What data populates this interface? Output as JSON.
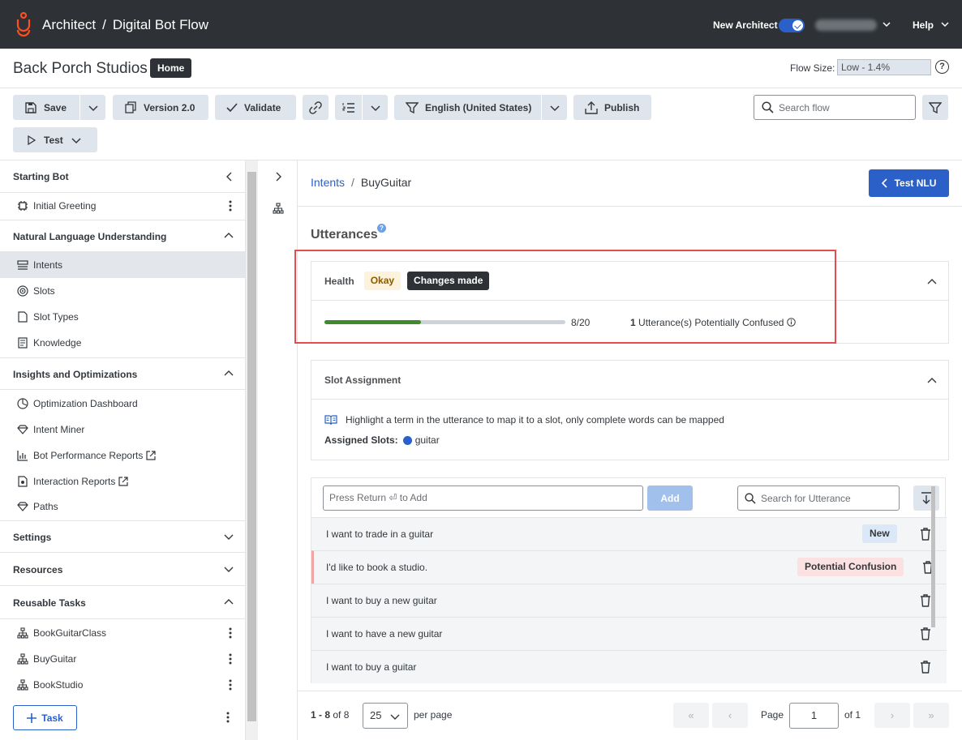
{
  "header": {
    "app_name": "Architect",
    "separator": "/",
    "flow_type": "Digital Bot Flow",
    "new_architect_label": "New Architect",
    "new_architect_enabled": true,
    "help_label": "Help"
  },
  "org": {
    "name": "Back Porch Studios",
    "home_label": "Home",
    "flow_size_label": "Flow Size:",
    "flow_size_value": "Low - 1.4%"
  },
  "toolbar": {
    "save_label": "Save",
    "version_label": "Version 2.0",
    "validate_label": "Validate",
    "language_label": "English (United States)",
    "publish_label": "Publish",
    "test_label": "Test",
    "search_placeholder": "Search flow"
  },
  "sidebar": {
    "starting_bot_header": "Starting Bot",
    "initial_greeting": "Initial Greeting",
    "nlu_header": "Natural Language Understanding",
    "nlu_items": [
      "Intents",
      "Slots",
      "Slot Types",
      "Knowledge"
    ],
    "insights_header": "Insights and Optimizations",
    "insights_items": [
      "Optimization Dashboard",
      "Intent Miner",
      "Bot Performance Reports",
      "Interaction Reports",
      "Paths"
    ],
    "settings_header": "Settings",
    "resources_header": "Resources",
    "reusable_header": "Reusable Tasks",
    "tasks": [
      "BookGuitarClass",
      "BuyGuitar",
      "BookStudio"
    ],
    "add_task_label": "Task"
  },
  "main": {
    "breadcrumb_root": "Intents",
    "breadcrumb_sep": "/",
    "breadcrumb_current": "BuyGuitar",
    "test_nlu_label": "Test NLU",
    "utterances_title": "Utterances",
    "health": {
      "label": "Health",
      "status": "Okay",
      "changes": "Changes made",
      "progress_current": 8,
      "progress_total": 20,
      "progress_text": "8/20",
      "confused_count": "1",
      "confused_text": "Utterance(s) Potentially Confused"
    },
    "slot_assignment": {
      "title": "Slot Assignment",
      "hint": "Highlight a term in the utterance to map it to a slot, only complete words can be mapped",
      "assigned_label": "Assigned Slots:",
      "slot_name": "guitar",
      "slot_color": "#2a60c8"
    },
    "utterance_input_placeholder": "Press Return ⏎ to Add",
    "add_label": "Add",
    "utterance_search_placeholder": "Search for Utterance",
    "utterances": [
      {
        "text": "I want to trade in a guitar",
        "badge": "New"
      },
      {
        "text": "I'd like to book a studio.",
        "badge": "Potential Confusion"
      },
      {
        "text": "I want to buy a new guitar",
        "badge": ""
      },
      {
        "text": "I want to have a new guitar",
        "badge": ""
      },
      {
        "text": "I want to buy a guitar",
        "badge": ""
      }
    ],
    "pager": {
      "range": "1 - 8",
      "of_total": "of 8",
      "per_page": "25",
      "per_page_label": "per page",
      "page_label": "Page",
      "page_value": "1",
      "page_of": "of 1"
    }
  }
}
